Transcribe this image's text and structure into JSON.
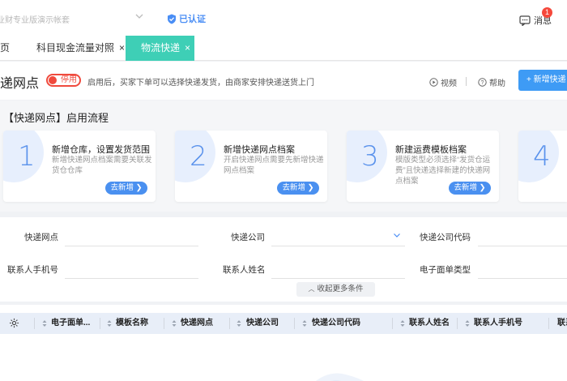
{
  "topbar": {
    "account_placeholder": "业财专业版演示帐套",
    "verified_label": "已认证",
    "message_label": "消息",
    "message_count": "1"
  },
  "tabs": [
    {
      "label": "页",
      "active": false,
      "closable": false
    },
    {
      "label": "科目现金流量对照",
      "active": false,
      "closable": true
    },
    {
      "label": "物流快递",
      "active": true,
      "closable": true
    }
  ],
  "header": {
    "title": "递网点",
    "toggle_label": "停用",
    "toggle_state": "off",
    "hint": "启用后，买家下单可以选择快递发货，由商家安排快递送货上门",
    "video_label": "视频",
    "help_label": "帮助",
    "add_button": "+ 新增快递"
  },
  "flow": {
    "title": "【快递网点】启用流程",
    "steps": [
      {
        "num": "1",
        "title": "新增仓库，设置发货范围",
        "desc": "新增快递网点档案需要关联发货仓仓库",
        "button": "去新增 ❯"
      },
      {
        "num": "2",
        "title": "新增快递网点档案",
        "desc": "开启快递网点需要先新增快递网点档案",
        "button": "去新增 ❯"
      },
      {
        "num": "3",
        "title": "新建运费模板档案",
        "desc": "模版类型必须选择“发货仓运费”且快递选择新建的快递网点档案",
        "button": "去新增 ❯"
      },
      {
        "num": "4",
        "title": "",
        "desc": "",
        "button": ""
      }
    ]
  },
  "filters": {
    "row1": [
      "快递网点",
      "快递公司",
      "快递公司代码"
    ],
    "row2": [
      "联系人手机号",
      "联系人姓名",
      "电子面单类型"
    ],
    "collapse_label": "收起更多条件"
  },
  "table": {
    "columns": [
      "电子面单...",
      "模板名称",
      "快递网点",
      "快递公司",
      "快递公司代码",
      "联系人姓名",
      "联系人手机号",
      "联系"
    ]
  },
  "colors": {
    "accent": "#3e9bf5",
    "active_tab": "#3ecfb6",
    "toggle_off": "#f04a3d",
    "badge": "#f5483b",
    "table_header": "#e8eef8"
  },
  "icons": [
    "chevron-down-icon",
    "shield-check-icon",
    "message-icon",
    "close-icon",
    "play-circle-icon",
    "question-circle-icon",
    "chevron-right-icon",
    "chevron-up-icon",
    "gear-icon",
    "sort-icon"
  ]
}
